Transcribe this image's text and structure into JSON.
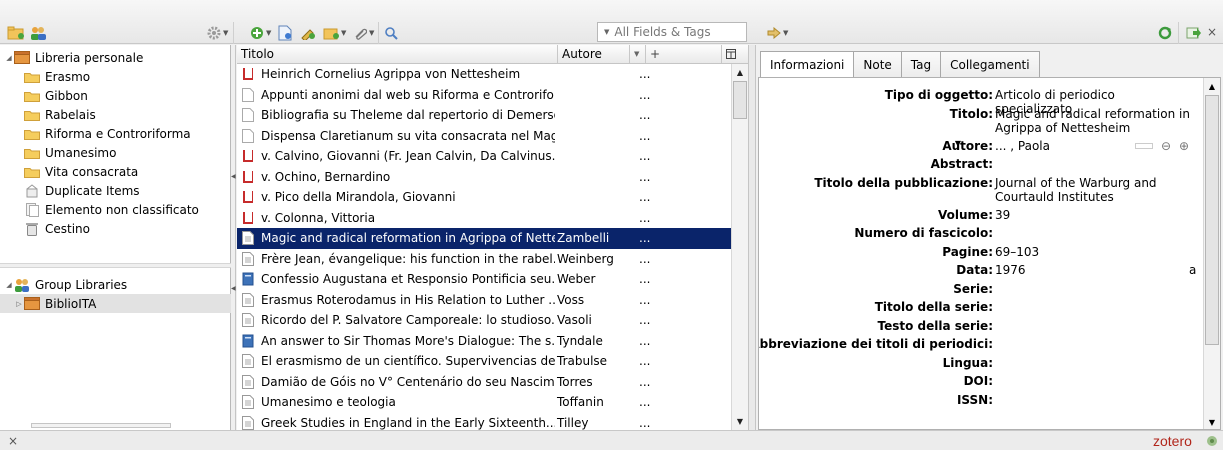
{
  "toolbar": {
    "search_placeholder": "All Fields & Tags",
    "close_symbol": "×"
  },
  "collections": [
    {
      "label": "Libreria personale",
      "icon": "library-icon",
      "level": 0,
      "twisty": "◢"
    },
    {
      "label": "Erasmo",
      "icon": "folder-icon",
      "level": 1
    },
    {
      "label": "Gibbon",
      "icon": "folder-icon",
      "level": 1
    },
    {
      "label": "Rabelais",
      "icon": "folder-icon",
      "level": 1
    },
    {
      "label": "Riforma e Controriforma",
      "icon": "folder-icon",
      "level": 1
    },
    {
      "label": "Umanesimo",
      "icon": "folder-icon",
      "level": 1
    },
    {
      "label": "Vita consacrata",
      "icon": "folder-icon",
      "level": 1
    },
    {
      "label": "Duplicate Items",
      "icon": "duplicate-icon",
      "level": 1
    },
    {
      "label": "Elemento non classificato",
      "icon": "unfiled-icon",
      "level": 1
    },
    {
      "label": "Cestino",
      "icon": "trash-icon",
      "level": 1
    }
  ],
  "group_libraries": {
    "label": "Group Libraries",
    "items": [
      {
        "label": "BiblioITA",
        "selected": true
      }
    ]
  },
  "items_columns": {
    "title": "Titolo",
    "author": "Autore",
    "plus": "+"
  },
  "items": [
    {
      "icon": "book",
      "title": "Heinrich Cornelius Agrippa von Nettesheim",
      "author": "",
      "dots": "..."
    },
    {
      "icon": "page",
      "title": "Appunti anonimi dal web su Riforma e Controrifo...",
      "author": "",
      "dots": "..."
    },
    {
      "icon": "page",
      "title": "Bibliografia su Theleme dal repertorio di Demerson",
      "author": "",
      "dots": "..."
    },
    {
      "icon": "page",
      "title": "Dispensa Claretianum su vita consacrata nel Mag...",
      "author": "",
      "dots": "..."
    },
    {
      "icon": "book",
      "title": "v. Calvino, Giovanni (Fr. Jean Calvin, Da Calvinus...",
      "author": "",
      "dots": "..."
    },
    {
      "icon": "book",
      "title": "v. Ochino, Bernardino",
      "author": "",
      "dots": "..."
    },
    {
      "icon": "book",
      "title": "v. Pico della Mirandola, Giovanni",
      "author": "",
      "dots": "..."
    },
    {
      "icon": "book",
      "title": "v. Colonna, Vittoria",
      "author": "",
      "dots": "..."
    },
    {
      "icon": "article",
      "title": "Magic and radical reformation in Agrippa of Nette...",
      "author": "Zambelli",
      "dots": "...",
      "selected": true
    },
    {
      "icon": "article",
      "title": "Frère Jean, évangelique: his function in the rabel...",
      "author": "Weinberg",
      "dots": "..."
    },
    {
      "icon": "bluebook",
      "title": "Confessio Augustana  et Responsio Pontificia seu...",
      "author": "Weber",
      "dots": "..."
    },
    {
      "icon": "article",
      "title": "Erasmus Roterodamus in His Relation to Luther ...",
      "author": "Voss",
      "dots": "..."
    },
    {
      "icon": "article",
      "title": "Ricordo del P. Salvatore Camporeale: lo studioso...",
      "author": "Vasoli",
      "dots": "..."
    },
    {
      "icon": "bluebook",
      "title": "An answer to Sir Thomas More's Dialogue: The s...",
      "author": "Tyndale",
      "dots": "..."
    },
    {
      "icon": "article",
      "title": "El erasmismo de un científico. Supervivencias del...",
      "author": "Trabulse",
      "dots": "..."
    },
    {
      "icon": "article",
      "title": "Damião de Góis no V° Centenário do seu Nascim...",
      "author": "Torres",
      "dots": "..."
    },
    {
      "icon": "article",
      "title": "Umanesimo e teologia",
      "author": "Toffanin",
      "dots": "..."
    },
    {
      "icon": "article",
      "title": "Greek Studies in England in the Early Sixteenth...",
      "author": "Tilley",
      "dots": "..."
    }
  ],
  "tabs": [
    "Informazioni",
    "Note",
    "Tag",
    "Collegamenti"
  ],
  "info_fields": [
    {
      "label": "Tipo di oggetto:",
      "value": "Articolo di periodico specializzato",
      "lines": 1
    },
    {
      "label": "Titolo:",
      "value": "Magic and radical reformation in Agrippa of Nettesheim",
      "lines": 2
    },
    {
      "label": "Autore:",
      "value": "... , Paola",
      "lines": 1,
      "creator": true
    },
    {
      "label": "Abstract:",
      "value": "",
      "lines": 1
    },
    {
      "label": "Titolo della pubblicazione:",
      "value": "Journal of the Warburg and Courtauld Institutes",
      "lines": 2
    },
    {
      "label": "Volume:",
      "value": "39",
      "lines": 1
    },
    {
      "label": "Numero di fascicolo:",
      "value": "",
      "lines": 1
    },
    {
      "label": "Pagine:",
      "value": "69–103",
      "lines": 1
    },
    {
      "label": "Data:",
      "value": "1976",
      "lines": 1,
      "extra": "a"
    },
    {
      "label": "Serie:",
      "value": "",
      "lines": 1
    },
    {
      "label": "Titolo della serie:",
      "value": "",
      "lines": 1
    },
    {
      "label": "Testo della serie:",
      "value": "",
      "lines": 1
    },
    {
      "label": "Abbreviazione dei titoli di periodici:",
      "value": "",
      "lines": 1
    },
    {
      "label": "Lingua:",
      "value": "",
      "lines": 1
    },
    {
      "label": "DOI:",
      "value": "",
      "lines": 1
    },
    {
      "label": "ISSN:",
      "value": "",
      "lines": 1
    }
  ],
  "status": {
    "close": "×",
    "logo": "zotero"
  },
  "colors": {
    "selection": "#0a246a",
    "folder": "#f2c45a",
    "book": "#c62b2b",
    "bluebook": "#3d72b8",
    "zotero_red": "#b1261b"
  }
}
